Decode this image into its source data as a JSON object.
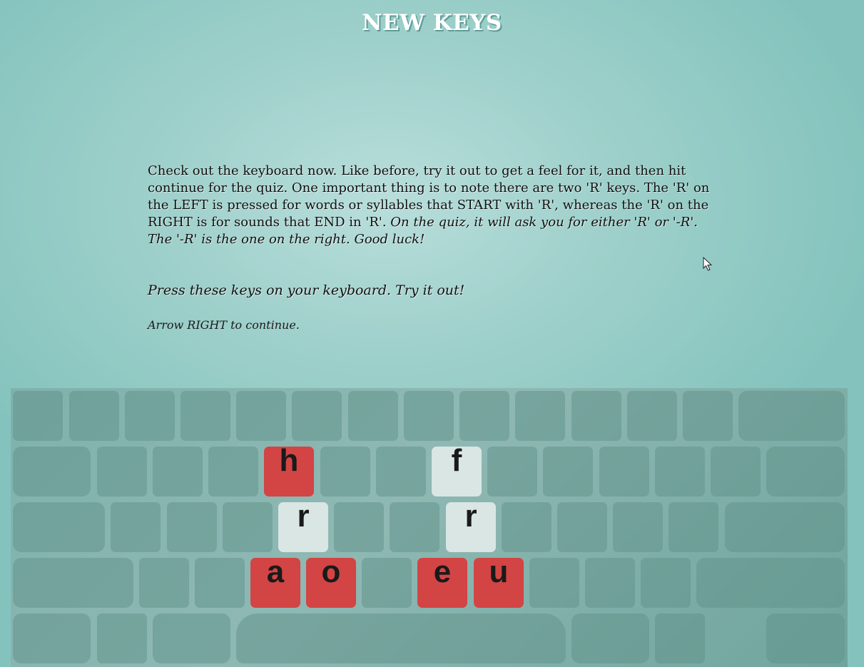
{
  "title": "NEW KEYS",
  "intro": {
    "text": "Check out the keyboard now. Like before, try it out to get a feel for it, and then hit continue for the quiz. One important thing is to note there are two 'R' keys. The 'R' on the LEFT is pressed for words or syllables that START with 'R', whereas the 'R' on the RIGHT is for sounds that END in 'R'. ",
    "emphasis": "On the quiz, it will ask you for either 'R' or '-R'. The '-R' is the one on the right. Good luck!"
  },
  "try_it": "Press these keys on your keyboard. Try it out!",
  "continue_hint": "Arrow RIGHT to continue.",
  "keyboard": {
    "highlight_colors": {
      "red": "#d34444",
      "light": "#d9e6e4"
    },
    "keys": {
      "h": "h",
      "f": "f",
      "r_left": "r",
      "r_right": "r",
      "a": "a",
      "o": "o",
      "e": "e",
      "u": "u"
    }
  }
}
